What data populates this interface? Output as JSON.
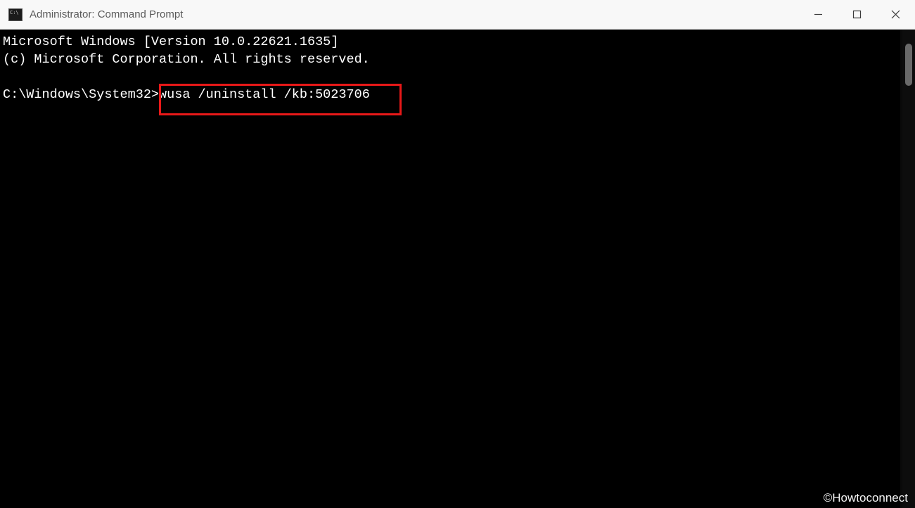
{
  "window": {
    "title": "Administrator: Command Prompt"
  },
  "terminal": {
    "line1": "Microsoft Windows [Version 10.0.22621.1635]",
    "line2": "(c) Microsoft Corporation. All rights reserved.",
    "blank": "",
    "prompt": "C:\\Windows\\System32>",
    "command": "wusa /uninstall /kb:5023706"
  },
  "watermark": "©Howtoconnect"
}
